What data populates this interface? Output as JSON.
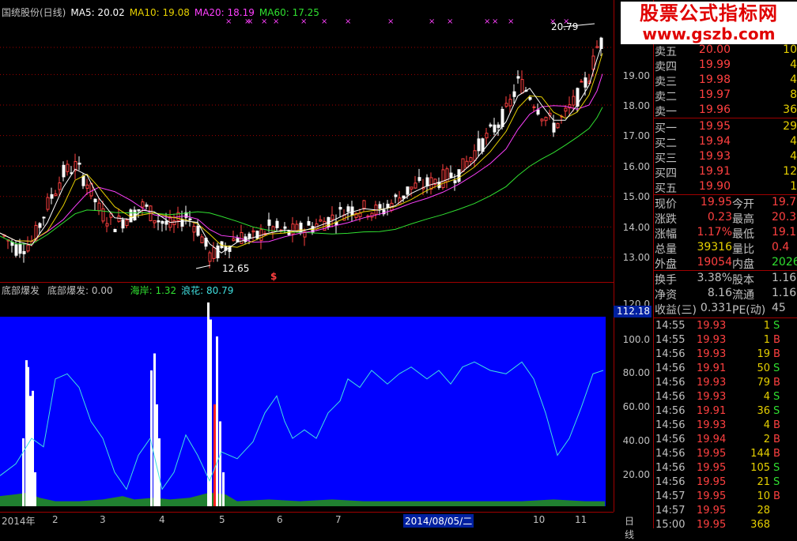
{
  "price_legend": {
    "name": "国统股份(日线)",
    "ma5": "MA5: 20.02",
    "ma10": "MA10: 19.08",
    "ma20": "MA20: 18.19",
    "ma60": "MA60: 17.25"
  },
  "price_labels": {
    "high": "20.79",
    "low": "12.65",
    "marker": "$"
  },
  "price_axis": [
    "19.00",
    "18.00",
    "17.00",
    "16.00",
    "15.00",
    "14.00",
    "13.00"
  ],
  "indicator_legend": {
    "name": "底部爆发",
    "value": "底部爆发: 0.00",
    "haian": "海岸: 1.32",
    "langhua": "浪花: 80.79"
  },
  "indicator_axis": [
    "120.0",
    "100.0",
    "80.00",
    "60.00",
    "40.00",
    "20.00"
  ],
  "indicator_current": "112.18",
  "date_axis": {
    "labels": [
      "2014年",
      "2",
      "3",
      "4",
      "5",
      "6",
      "7",
      "2014/08/05/二",
      "10",
      "11"
    ],
    "period": "日线"
  },
  "watermark": {
    "line1": "股票公式指标网",
    "line2": "www.gszb.com"
  },
  "colors": {
    "ma5": "#ffffff",
    "ma10": "#e6d000",
    "ma20": "#ff40ff",
    "ma60": "#30e030",
    "up": "#ff4040",
    "down": "#30e030",
    "blue_fill": "#0000ff",
    "langhua": "#40e0e0"
  },
  "quotes": {
    "asks": [
      {
        "label": "卖五",
        "price": "20.00",
        "vol": "10"
      },
      {
        "label": "卖四",
        "price": "19.99",
        "vol": "4"
      },
      {
        "label": "卖三",
        "price": "19.98",
        "vol": "4"
      },
      {
        "label": "卖二",
        "price": "19.97",
        "vol": "8"
      },
      {
        "label": "卖一",
        "price": "19.96",
        "vol": "36"
      }
    ],
    "bids": [
      {
        "label": "买一",
        "price": "19.95",
        "vol": "29"
      },
      {
        "label": "买二",
        "price": "19.94",
        "vol": "4"
      },
      {
        "label": "买三",
        "price": "19.93",
        "vol": "4"
      },
      {
        "label": "买四",
        "price": "19.91",
        "vol": "12"
      },
      {
        "label": "买五",
        "price": "19.90",
        "vol": "1"
      }
    ]
  },
  "stats": [
    {
      "l1": "现价",
      "v1": "19.95",
      "l2": "今开",
      "v2": "19.7"
    },
    {
      "l1": "涨跌",
      "v1": "0.23",
      "l2": "最高",
      "v2": "20.3"
    },
    {
      "l1": "涨幅",
      "v1": "1.17%",
      "l2": "最低",
      "v2": "19.1"
    },
    {
      "l1": "总量",
      "v1": "39316",
      "l2": "量比",
      "v2": "0.4"
    },
    {
      "l1": "外盘",
      "v1": "19054",
      "l2": "内盘",
      "v2": "2026"
    }
  ],
  "stats2": [
    {
      "l1": "换手",
      "v1": "3.38%",
      "l2": "股本",
      "v2": "1.16"
    },
    {
      "l1": "净资",
      "v1": "8.16",
      "l2": "流通",
      "v2": "1.16"
    },
    {
      "l1": "收益(三)",
      "v1": "0.331",
      "l2": "PE(动)",
      "v2": "45"
    }
  ],
  "ticks": [
    {
      "time": "14:55",
      "price": "19.93",
      "vol": "1",
      "bs": "S"
    },
    {
      "time": "14:55",
      "price": "19.93",
      "vol": "1",
      "bs": "B"
    },
    {
      "time": "14:56",
      "price": "19.93",
      "vol": "19",
      "bs": "B"
    },
    {
      "time": "14:56",
      "price": "19.91",
      "vol": "50",
      "bs": "S"
    },
    {
      "time": "14:56",
      "price": "19.93",
      "vol": "79",
      "bs": "B"
    },
    {
      "time": "14:56",
      "price": "19.93",
      "vol": "4",
      "bs": "S"
    },
    {
      "time": "14:56",
      "price": "19.91",
      "vol": "36",
      "bs": "S"
    },
    {
      "time": "14:56",
      "price": "19.93",
      "vol": "4",
      "bs": "B"
    },
    {
      "time": "14:56",
      "price": "19.94",
      "vol": "2",
      "bs": "B"
    },
    {
      "time": "14:56",
      "price": "19.95",
      "vol": "144",
      "bs": "B"
    },
    {
      "time": "14:56",
      "price": "19.95",
      "vol": "105",
      "bs": "S"
    },
    {
      "time": "14:56",
      "price": "19.95",
      "vol": "21",
      "bs": "S"
    },
    {
      "time": "14:57",
      "price": "19.95",
      "vol": "10",
      "bs": "B"
    },
    {
      "time": "14:57",
      "price": "19.95",
      "vol": "28",
      "bs": ""
    },
    {
      "time": "15:00",
      "price": "19.95",
      "vol": "368",
      "bs": ""
    }
  ]
}
